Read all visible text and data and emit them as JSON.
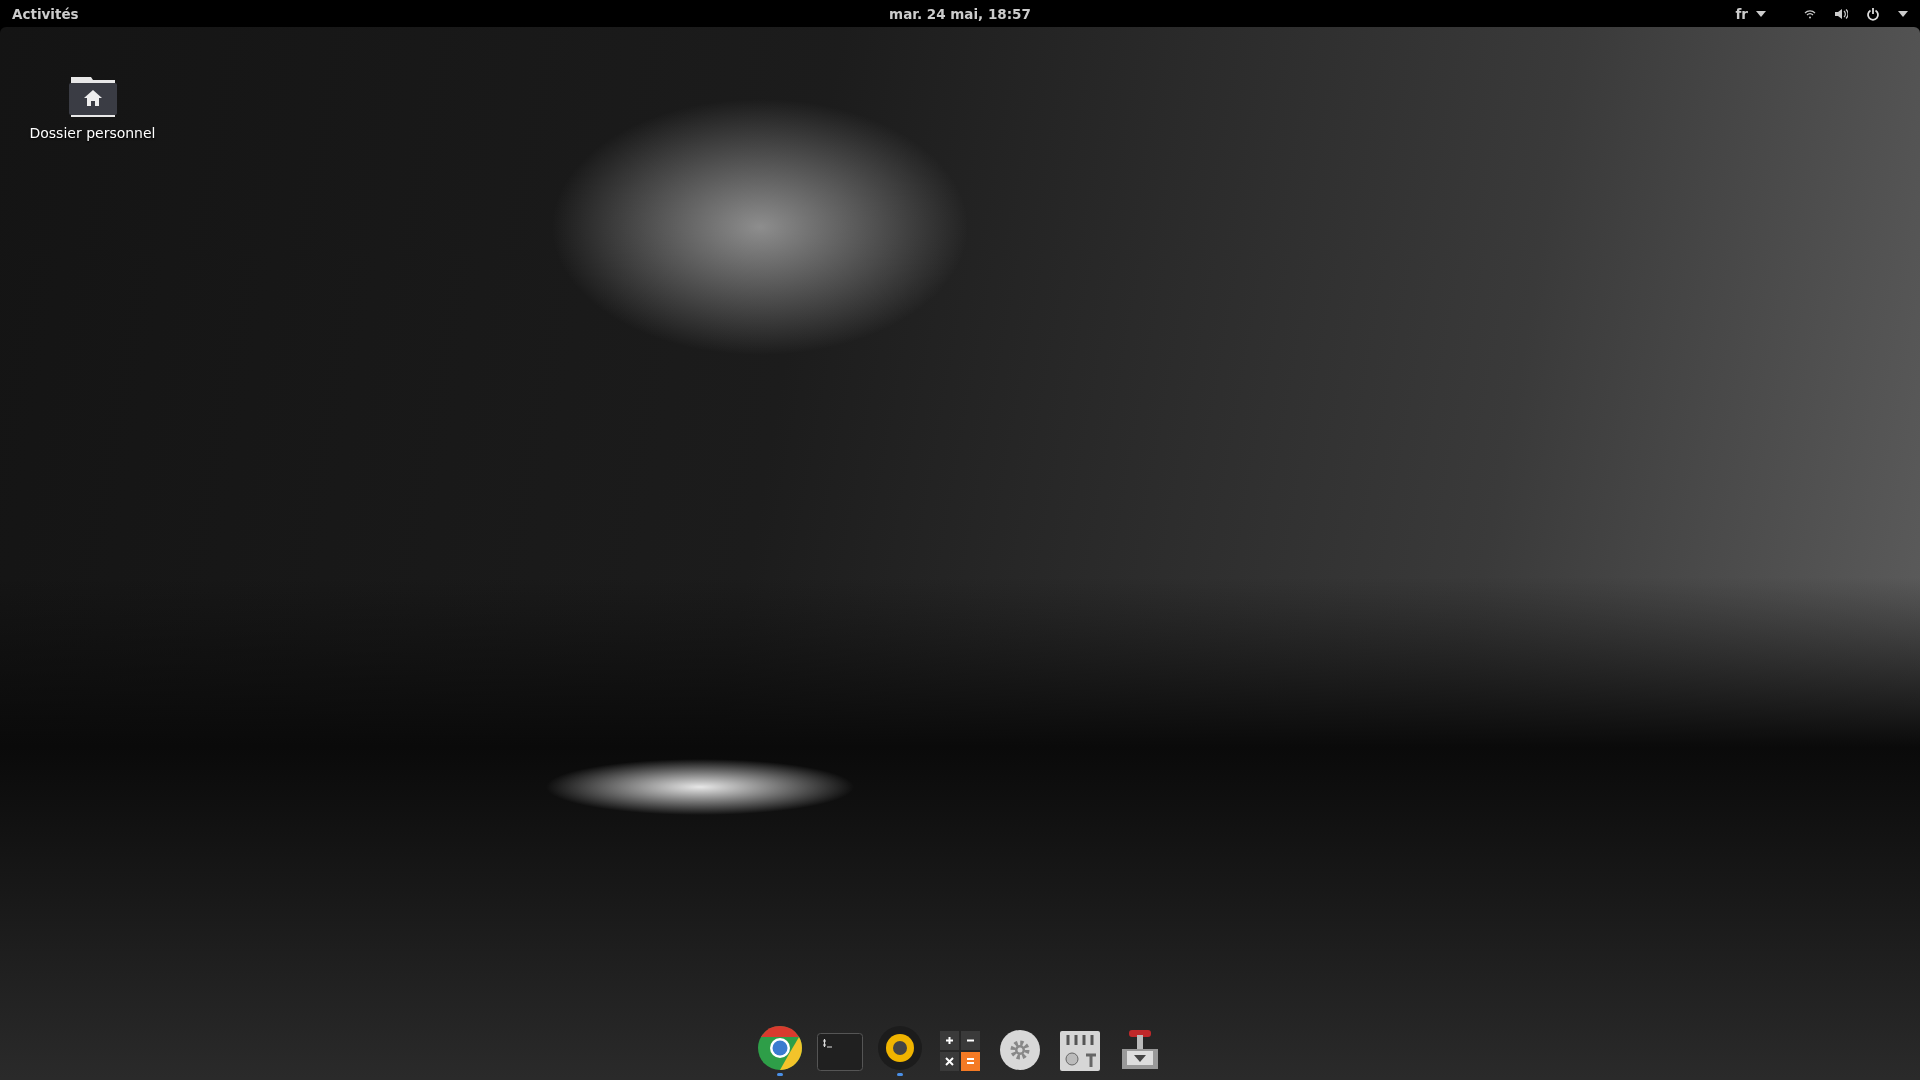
{
  "top_bar": {
    "activities": "Activités",
    "clock": "mar. 24 mai, 18:57",
    "keyboard_layout": "fr"
  },
  "desktop_icons": [
    {
      "label": "Dossier personnel"
    }
  ],
  "dock": [
    {
      "kind": "browser",
      "running": true
    },
    {
      "kind": "terminal",
      "running": false
    },
    {
      "kind": "music",
      "running": true
    },
    {
      "kind": "calculator",
      "running": false
    },
    {
      "kind": "settings",
      "running": false
    },
    {
      "kind": "mixer",
      "running": false
    },
    {
      "kind": "downloader",
      "running": false
    }
  ]
}
